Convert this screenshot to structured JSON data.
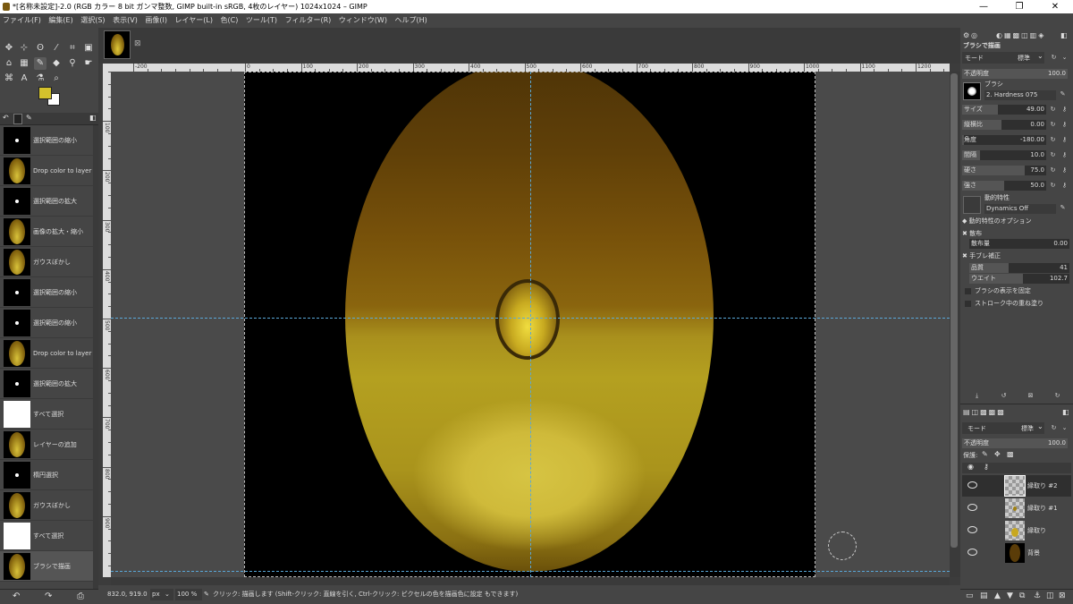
{
  "window": {
    "title": "*[名称未設定]-2.0 (RGB カラー 8 bit ガンマ整数, GIMP built-in sRGB, 4枚のレイヤー) 1024x1024 – GIMP",
    "minimize": "—",
    "maximize": "❐",
    "close": "✕"
  },
  "menu": [
    "ファイル(F)",
    "編集(E)",
    "選択(S)",
    "表示(V)",
    "画像(I)",
    "レイヤー(L)",
    "色(C)",
    "ツール(T)",
    "フィルター(R)",
    "ウィンドウ(W)",
    "ヘルプ(H)"
  ],
  "toolbox": {
    "fg_color": "#d4c22c",
    "bg_color": "#ffffff",
    "tools": [
      "move-icon",
      "align-icon",
      "lasso-icon",
      "fuzzy-select-icon",
      "crop-icon",
      "transform-icon",
      "warp-icon",
      "bucket-icon",
      "paintbrush-icon",
      "eraser-icon",
      "clone-icon",
      "smudge-icon",
      "path-icon",
      "text-icon",
      "color-picker-icon",
      "zoom-icon"
    ]
  },
  "undo_history": [
    {
      "label": "選択範囲の縮小",
      "thumb": "dot"
    },
    {
      "label": "Drop color to layer",
      "thumb": "egg"
    },
    {
      "label": "選択範囲の拡大",
      "thumb": "dot"
    },
    {
      "label": "画像の拡大・縮小",
      "thumb": "egg"
    },
    {
      "label": "ガウスぼかし",
      "thumb": "egg"
    },
    {
      "label": "選択範囲の縮小",
      "thumb": "dot"
    },
    {
      "label": "選択範囲の縮小",
      "thumb": "dot"
    },
    {
      "label": "Drop color to layer",
      "thumb": "egg"
    },
    {
      "label": "選択範囲の拡大",
      "thumb": "dot"
    },
    {
      "label": "すべて選択",
      "thumb": "white"
    },
    {
      "label": "レイヤーの追加",
      "thumb": "egg"
    },
    {
      "label": "楕円選択",
      "thumb": "dot"
    },
    {
      "label": "ガウスぼかし",
      "thumb": "egg"
    },
    {
      "label": "すべて選択",
      "thumb": "white"
    },
    {
      "label": "ブラシで描画",
      "thumb": "egg"
    }
  ],
  "ruler": {
    "h_labels": [
      "-200",
      "0",
      "100",
      "200",
      "300",
      "400",
      "500",
      "600",
      "700",
      "800",
      "900",
      "1000",
      "1100",
      "1200"
    ],
    "v_labels": [
      "100",
      "200",
      "300",
      "400",
      "500",
      "600",
      "700",
      "800",
      "900"
    ]
  },
  "status": {
    "coords": "832.0, 919.0",
    "unit": "px",
    "zoom": "100 %",
    "message": "クリック: 描画します (Shift-クリック: 直線を引く, Ctrl-クリック: ピクセルの色を描画色に設定 もできます)"
  },
  "tool_options": {
    "title": "ブラシで描画",
    "mode_label": "モード",
    "mode_value": "標準",
    "opacity_label": "不透明度",
    "opacity_value": "100.0",
    "brush_label": "ブラシ",
    "brush_name": "2. Hardness 075",
    "size_label": "サイズ",
    "size_value": "49.00",
    "aspect_label": "縦横比",
    "aspect_value": "0.00",
    "angle_label": "角度",
    "angle_value": "-180.00",
    "spacing_label": "間隔",
    "spacing_value": "10.0",
    "hardness_label": "硬さ",
    "hardness_value": "75.0",
    "force_label": "強さ",
    "force_value": "50.0",
    "dynamics_label": "動的特性",
    "dynamics_value": "Dynamics Off",
    "dynamics_options": "動的特性のオプション",
    "scatter_label": "散布",
    "scatter_amount_label": "散布量",
    "scatter_amount_value": "0.00",
    "smooth_label": "手ブレ補正",
    "quality_label": "品質",
    "quality_value": "41",
    "weight_label": "ウエイト",
    "weight_value": "102.7",
    "lock_brush": "ブラシの表示を固定",
    "incremental": "ストローク中の重ね塗り"
  },
  "layers_panel": {
    "mode_label": "モード",
    "mode_value": "標準",
    "opacity_label": "不透明度",
    "opacity_value": "100.0",
    "lock_label": "保護:",
    "layers": [
      {
        "name": "縁取り #2",
        "kind": "transparent"
      },
      {
        "name": "縁取り #1",
        "kind": "transparent-egg"
      },
      {
        "name": "縁取り",
        "kind": "transparent-egg2"
      },
      {
        "name": "背景",
        "kind": "egg"
      }
    ]
  }
}
